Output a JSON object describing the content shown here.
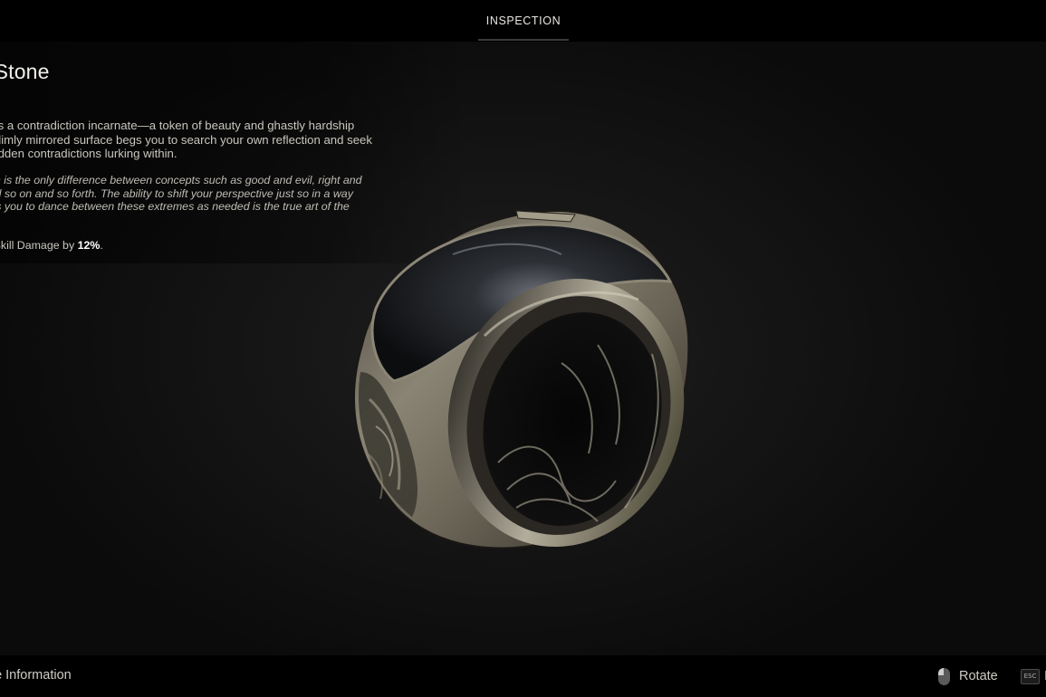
{
  "topbar": {
    "tab_label": "INSPECTION"
  },
  "item": {
    "name": "aed Stone",
    "type": "g",
    "description_lines": [
      "ring is a contradiction incarnate—a token of beauty and ghastly hardship",
      ". Its dimly mirrored surface begs you to search your own reflection and seek",
      "he hidden contradictions lurking within."
    ],
    "quote_lines": [
      "eption is the only difference between concepts such as good and evil, right and",
      "g, and so on and so forth. The ability to shift your perspective just so in a way",
      "allows you to dance between these extremes as needed is the true art of the"
    ],
    "effect_prefix": "ases Skill Damage by ",
    "effect_value": "12%",
    "effect_suffix": "."
  },
  "bottombar": {
    "hide_info_label": "de Information",
    "rotate_label": "Rotate",
    "esc_key": "ESC",
    "esc_label": "I",
    "rotate_icon": "mouse-icon"
  },
  "colors": {
    "background": "#0b0b0b",
    "bar": "#000000",
    "text": "#d6d3cc",
    "highlight": "#ffffff"
  }
}
